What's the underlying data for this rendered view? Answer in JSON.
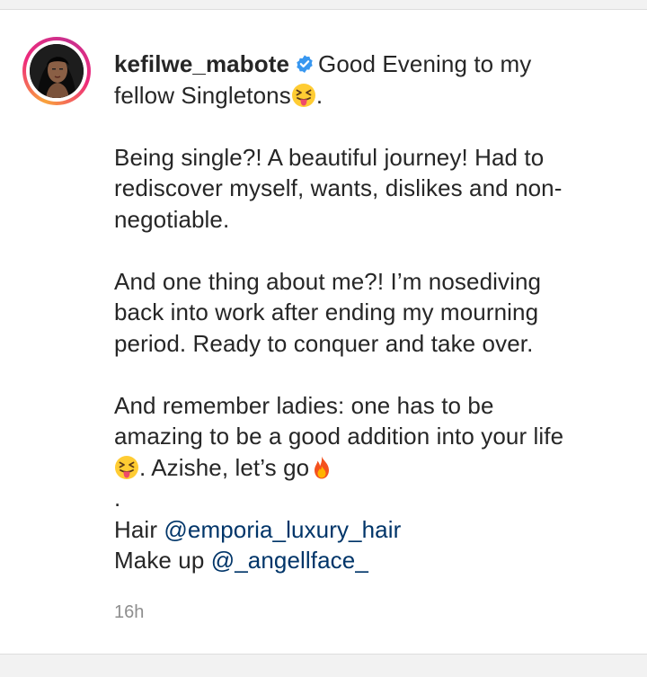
{
  "post": {
    "username": "kefilwe_mabote",
    "verified": true,
    "lines": {
      "l1": "Good Evening to my",
      "l2": "fellow Singletons",
      "l2_end": ".",
      "l3": "Being single?! A beautiful journey! Had to",
      "l4": "rediscover myself, wants, dislikes and non-",
      "l5": "negotiable.",
      "l6": "And one thing about me?! I’m nosediving",
      "l7": "back into work after ending my mourning",
      "l8": "period. Ready to conquer and take over.",
      "l9": "And remember ladies: one has to be",
      "l10": "amazing to be a good addition into your life",
      "l11": ". Azishe, let’s go",
      "l12": ".",
      "hair_label": "Hair",
      "hair_mention": "@emporia_luxury_hair",
      "makeup_label": "Make up",
      "makeup_mention": "@_angellface_"
    },
    "time_ago": "16h"
  },
  "icons": {
    "verified_badge": "verified-badge-icon",
    "emoji_squint_tongue": "squinting-face-with-tongue-icon",
    "emoji_fire": "fire-icon"
  },
  "colors": {
    "text": "#262626",
    "mention": "#003569",
    "timestamp": "#8e8e8e",
    "verified": "#3897f0"
  }
}
